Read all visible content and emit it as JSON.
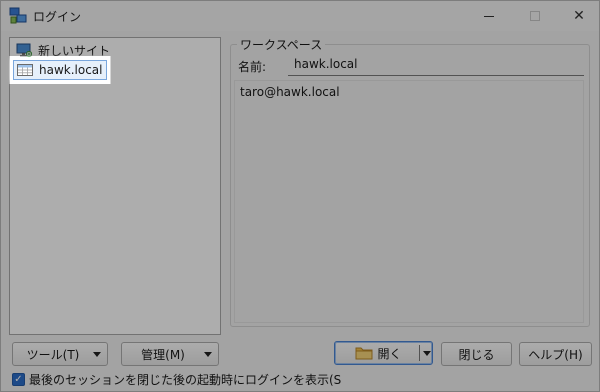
{
  "window": {
    "title": "ログイン",
    "close_glyph": "✕",
    "app_icon": "computer-network-icon"
  },
  "tree": {
    "items": [
      {
        "label": "新しいサイト",
        "icon": "monitor-icon"
      },
      {
        "label": "hawk.local",
        "icon": "site-grid-icon",
        "selected": true
      }
    ]
  },
  "workspace": {
    "group_title": "ワークスペース",
    "name_label": "名前:",
    "name_value": "hawk.local",
    "description": "taro@hawk.local"
  },
  "buttons": {
    "tools": "ツール(T)",
    "manage": "管理(M)",
    "open": "開く",
    "close": "閉じる",
    "help": "ヘルプ(H)"
  },
  "checkbox": {
    "checked": true,
    "label": "最後のセッションを閉じた後の起動時にログインを表示(S"
  },
  "colors": {
    "accent": "#2b6dc9",
    "selection_bg": "#e6f0fb",
    "window_bg": "#f0f0f0"
  }
}
